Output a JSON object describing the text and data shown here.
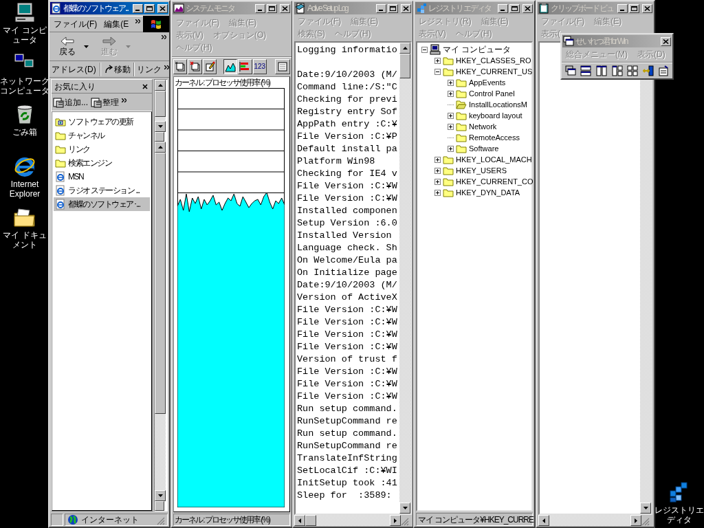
{
  "desktop_icons": [
    {
      "kind": "computer",
      "label": "マイ コンピュータ"
    },
    {
      "kind": "network",
      "label": "ネットワークコンピュータ"
    },
    {
      "kind": "recycle",
      "label": "ごみ箱"
    },
    {
      "kind": "browser",
      "label": "Internet Explorer"
    },
    {
      "kind": "documents",
      "label": "マイ ドキュメント"
    },
    {
      "kind": "registry",
      "label": "レジストリエディタ"
    }
  ],
  "browser": {
    "title": "都蝶のソフトウェア...",
    "active": true,
    "menu": [
      "ファイル(F)",
      "編集(E"
    ],
    "toolbar": [
      {
        "label": "戻る",
        "disabled": false
      },
      {
        "label": "進む",
        "disabled": true
      }
    ],
    "address_label": "アドレス(D)",
    "go_button": "移動",
    "links_label": "リンク",
    "favorites": {
      "title": "お気に入り",
      "add_button": "追加...",
      "organize_button": "整理",
      "items": [
        {
          "kind": "update",
          "label": "ソフトウェアの更新",
          "selected": false
        },
        {
          "kind": "folder",
          "label": "チャンネル",
          "selected": false
        },
        {
          "kind": "folder",
          "label": "リンク",
          "selected": false
        },
        {
          "kind": "folder",
          "label": "検索エンジン",
          "selected": false
        },
        {
          "kind": "page",
          "label": "MSN",
          "selected": false
        },
        {
          "kind": "page",
          "label": "ラジオ ステーション ...",
          "selected": false
        },
        {
          "kind": "page",
          "label": "都蝶のソフトウェア･...",
          "selected": true
        }
      ]
    },
    "status_text": "インターネット"
  },
  "system_monitor": {
    "title": "システム モニタ",
    "active": false,
    "menu": [
      [
        "ファイル(F)",
        "編集(E)"
      ],
      [
        "表示(V)",
        "オプション(O)"
      ],
      [
        "ヘルプ(H)"
      ]
    ],
    "view_modes": [
      {
        "kind": "line",
        "selected": true
      },
      {
        "kind": "bar",
        "selected": false
      },
      {
        "kind": "numeric",
        "label": "123",
        "selected": false
      }
    ],
    "chart_label": "カーネル : プロセッサ使用率 (%)",
    "status_text": "カーネル : プロセッサ使用率 (%)"
  },
  "setup_log": {
    "title": "Active Setup Log",
    "active": false,
    "menu": [
      [
        "ファイル(F)",
        "編集(E)"
      ],
      [
        "検索(S)",
        "ヘルプ(H)"
      ]
    ],
    "first_line": "Logging informatio",
    "lines": [
      "Date:9/10/2003 (M/",
      "Command line:/S:\"C",
      "Checking for previ",
      "Registry entry Sof",
      "AppPath entry :C:¥",
      "File Version :C:¥P",
      "Default install pa",
      "Platform Win98",
      "Checking for IE4 v",
      "File Version :C:¥W",
      "File Version :C:¥W",
      "Installed componen",
      "Setup Version :6.0",
      "Installed Version",
      "Language check. Sh",
      "On Welcome/Eula pa",
      "On Initialize page",
      "Date:9/10/2003 (M/",
      "Version of ActiveX",
      "File Version :C:¥W",
      "File Version :C:¥W",
      "File Version :C:¥W",
      "File Version :C:¥W",
      "Version of trust f",
      "File Version :C:¥W",
      "File Version :C:¥W",
      "File Version :C:¥W",
      "Run setup command.",
      "RunSetupCommand re",
      "Run setup command.",
      "RunSetupCommand re",
      "TranslateInfString",
      "SetLocalCif :C:¥WI",
      "InitSetup took :41",
      "Sleep for  :3589:"
    ]
  },
  "registry_editor": {
    "title": "レジストリ エディタ",
    "active": false,
    "menu": [
      [
        "レジストリ(R)",
        "編集(E)"
      ],
      [
        "表示(V)",
        "ヘルプ(H)"
      ]
    ],
    "tree": [
      {
        "kind": "computer",
        "label": "マイ コンピュータ",
        "expanded": true,
        "children": [
          {
            "kind": "folder",
            "label": "HKEY_CLASSES_RO",
            "expanded": false
          },
          {
            "kind": "folder",
            "label": "HKEY_CURRENT_US",
            "expanded": true,
            "children": [
              {
                "kind": "folder",
                "label": "AppEvents",
                "expanded": false
              },
              {
                "kind": "folder",
                "label": "Control Panel",
                "expanded": false
              },
              {
                "kind": "open-folder",
                "label": "InstallLocationsM"
              },
              {
                "kind": "folder",
                "label": "keyboard layout",
                "expanded": false
              },
              {
                "kind": "folder",
                "label": "Network",
                "expanded": false
              },
              {
                "kind": "folder",
                "label": "RemoteAccess"
              },
              {
                "kind": "folder",
                "label": "Software",
                "expanded": false
              }
            ]
          },
          {
            "kind": "folder",
            "label": "HKEY_LOCAL_MACH",
            "expanded": false
          },
          {
            "kind": "folder",
            "label": "HKEY_USERS",
            "expanded": false
          },
          {
            "kind": "folder",
            "label": "HKEY_CURRENT_CO",
            "expanded": false
          },
          {
            "kind": "folder",
            "label": "HKEY_DYN_DATA",
            "expanded": false
          }
        ]
      }
    ],
    "status_text": "マイ コンピュータ¥HKEY_CURRE"
  },
  "clipboard_viewer": {
    "title": "クリップボード ビュ",
    "active": false,
    "menu": [
      [
        "ファイル(F)",
        "編集(E)"
      ],
      [
        "表示("
      ]
    ]
  },
  "arrange_tool": {
    "title": "せいれつ君 for Win",
    "active": false,
    "menu": [
      [
        "総合メニュー(M)",
        "表示(D)"
      ]
    ]
  }
}
